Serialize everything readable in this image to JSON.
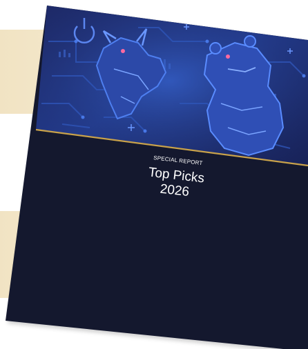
{
  "cover": {
    "kicker": "SPECIAL REPORT",
    "title_line1": "Top Picks",
    "title_line2": "2026",
    "colors": {
      "background": "#14182e",
      "accent_line": "#c9a24a",
      "art_blue": "#3f6fd8",
      "art_dark": "#1a2252",
      "band": "#f1e3c3"
    },
    "illustration_icons": [
      "bull-icon",
      "bear-icon",
      "circuit-board-icon"
    ]
  }
}
